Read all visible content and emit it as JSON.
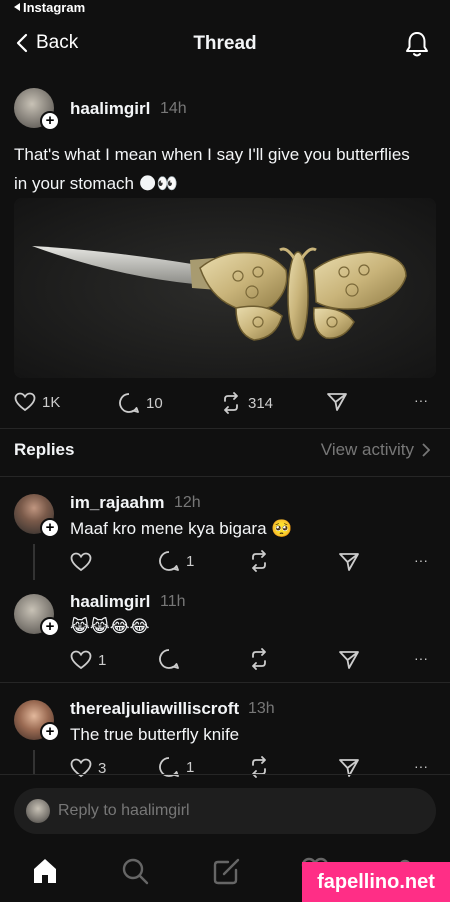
{
  "status_bar": {
    "back_app": "Instagram"
  },
  "header": {
    "back_label": "Back",
    "title": "Thread"
  },
  "post": {
    "username": "haalimgirl",
    "time": "14h",
    "text_line1": "That's what I mean when I say I'll give you butterflies",
    "text_line2": "in your stomach",
    "emojis": "🌑👀",
    "likes": "1K",
    "comments": "10",
    "reposts": "314",
    "more": "···"
  },
  "replies_section": {
    "heading": "Replies",
    "view_activity": "View activity"
  },
  "replies": [
    {
      "username": "im_rajaahm",
      "time": "12h",
      "text": "Maaf kro mene kya bigara",
      "emoji": "🥺",
      "likes": "",
      "comments": "1",
      "more": "···"
    },
    {
      "username": "haalimgirl",
      "time": "11h",
      "text": "",
      "emoji": "😹😹😂😂",
      "likes": "1",
      "comments": "",
      "more": "···"
    },
    {
      "username": "therealjuliawilliscroft",
      "time": "13h",
      "text": "The true butterfly knife",
      "emoji": "",
      "likes": "3",
      "comments": "1",
      "more": "···"
    }
  ],
  "reply_box": {
    "placeholder": "Reply to haalimgirl"
  },
  "watermark": "fapellino.net",
  "colors": {
    "background": "#101010",
    "text": "#f3f5f7",
    "muted": "#777777",
    "watermark": "#ff2e86"
  }
}
